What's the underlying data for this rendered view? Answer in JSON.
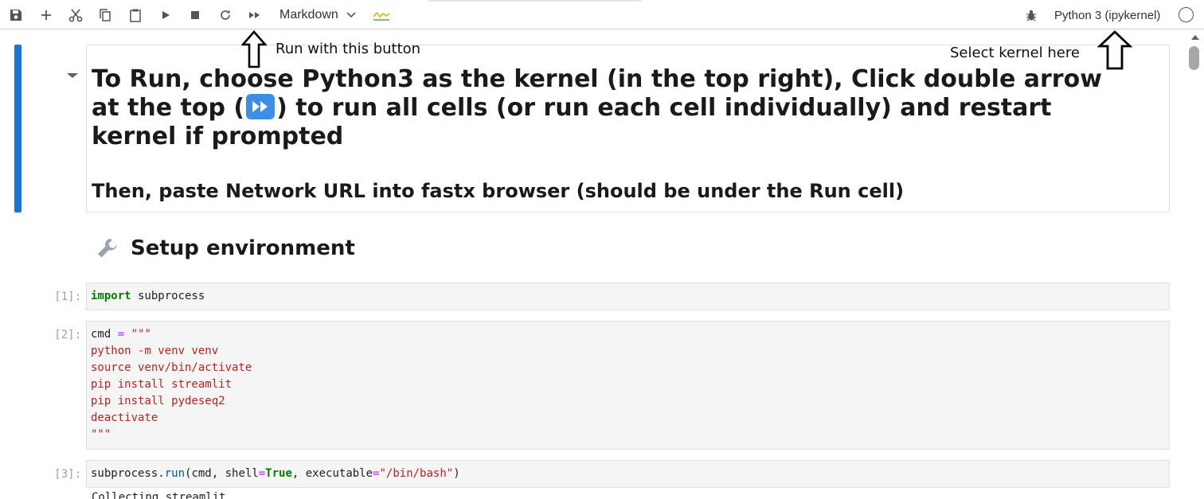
{
  "toolbar": {
    "buttons": [
      {
        "name": "save-button",
        "icon": "save-icon"
      },
      {
        "name": "insert-cell-button",
        "icon": "plus-icon"
      },
      {
        "name": "cut-button",
        "icon": "scissors-icon"
      },
      {
        "name": "copy-button",
        "icon": "copy-icon"
      },
      {
        "name": "paste-button",
        "icon": "clipboard-icon"
      },
      {
        "name": "run-cell-button",
        "icon": "play-icon"
      },
      {
        "name": "interrupt-button",
        "icon": "stop-icon"
      },
      {
        "name": "restart-kernel-button",
        "icon": "refresh-icon"
      },
      {
        "name": "run-all-button",
        "icon": "fast-forward-icon"
      }
    ],
    "cell_type": "Markdown",
    "kernel_name": "Python 3 (ipykernel)",
    "accent_color": "#1976d2"
  },
  "notebook": {
    "markdown_cell": {
      "heading_part1": "To Run, choose Python3 as the kernel (in the top right), Click double arrow at the top (",
      "heading_part2": ") to run all cells (or run each cell individually) and restart kernel if prompted",
      "subheading": "Then, paste Network URL into fastx browser (should be under the Run cell)"
    },
    "setup_heading": "Setup environment",
    "cells": [
      {
        "prompt": "[1]:"
      },
      {
        "prompt": "[2]:"
      },
      {
        "prompt": "[3]:"
      }
    ],
    "code": {
      "c1_keyword": "import",
      "c1_rest": " subprocess",
      "c2_var": "cmd ",
      "c2_eq": "=",
      "c2_open": " \"\"\"",
      "c2_lines": [
        "python -m venv venv",
        "source venv/bin/activate",
        "pip install streamlit",
        "pip install pydeseq2",
        "deactivate",
        "\"\"\""
      ],
      "c3_obj": "subprocess.",
      "c3_fn": "run",
      "c3_args1": "(cmd, shell",
      "c3_eq1": "=",
      "c3_true": "True",
      "c3_args2": ", executable",
      "c3_eq2": "=",
      "c3_str": "\"/bin/bash\"",
      "c3_close": ")"
    },
    "output_partial": "Collecting streamlit"
  },
  "annotations": {
    "run_hint": "Run with this button",
    "kernel_hint": "Select kernel here"
  }
}
